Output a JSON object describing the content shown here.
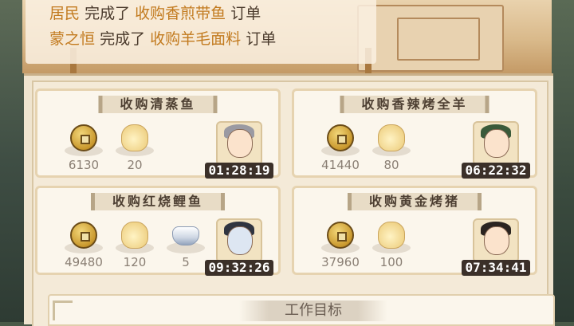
{
  "log": [
    {
      "name": "居民",
      "verb": "完成了",
      "item": "收购香煎带鱼",
      "tail": "订单"
    },
    {
      "name": "蒙之恒",
      "verb": "完成了",
      "item": "收购羊毛面料",
      "tail": "订单"
    }
  ],
  "orders": [
    {
      "title": "收购清蒸鱼",
      "rewards": [
        {
          "icon": "copper-coin-icon",
          "value": "6130"
        },
        {
          "icon": "bun-icon",
          "value": "20"
        }
      ],
      "timer": "01:28:19"
    },
    {
      "title": "收购香辣烤全羊",
      "rewards": [
        {
          "icon": "copper-coin-icon",
          "value": "41440"
        },
        {
          "icon": "bun-icon",
          "value": "80"
        }
      ],
      "timer": "06:22:32"
    },
    {
      "title": "收购红烧鲤鱼",
      "rewards": [
        {
          "icon": "copper-coin-icon",
          "value": "49480"
        },
        {
          "icon": "bun-icon",
          "value": "120"
        },
        {
          "icon": "silver-ingot-icon",
          "value": "5"
        }
      ],
      "timer": "09:32:26"
    },
    {
      "title": "收购黄金烤猪",
      "rewards": [
        {
          "icon": "copper-coin-icon",
          "value": "37960"
        },
        {
          "icon": "bun-icon",
          "value": "100"
        }
      ],
      "timer": "07:34:41"
    }
  ],
  "goal": {
    "title": "工作目标"
  }
}
